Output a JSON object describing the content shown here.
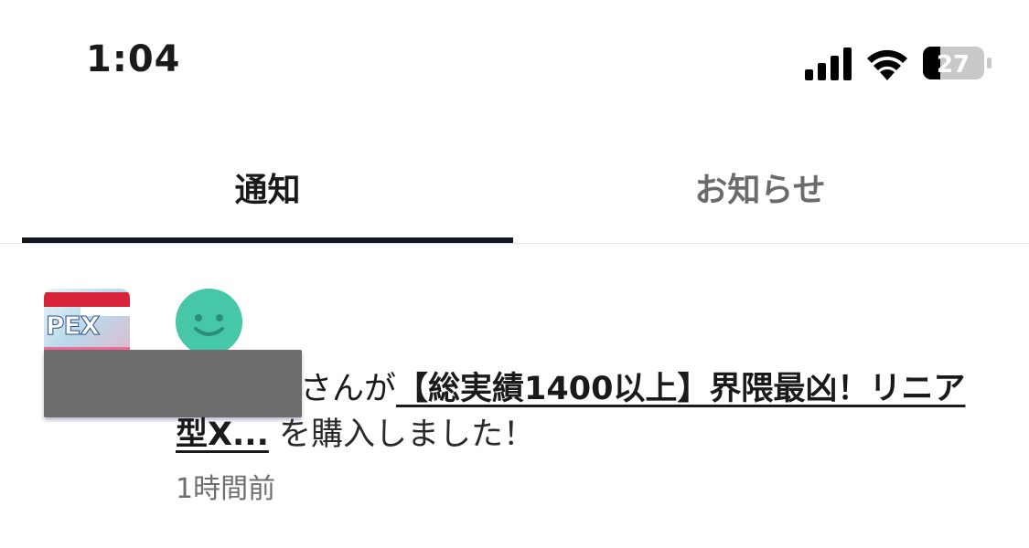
{
  "status_bar": {
    "time": "1:04",
    "battery_level": "27"
  },
  "tabs": [
    {
      "label": "通知",
      "active": true
    },
    {
      "label": "お知らせ",
      "active": false
    }
  ],
  "notification": {
    "text_before": "さんが",
    "product_title": "【総実績1400以上】界隈最凶！リニア型X...",
    "text_after": " を購入しました！",
    "timestamp": "1時間前"
  },
  "colors": {
    "tab_underline": "#111820",
    "avatar_bg": "#45c7a8",
    "inactive_tab": "#6b6b6b",
    "timestamp": "#6e6e6e"
  }
}
